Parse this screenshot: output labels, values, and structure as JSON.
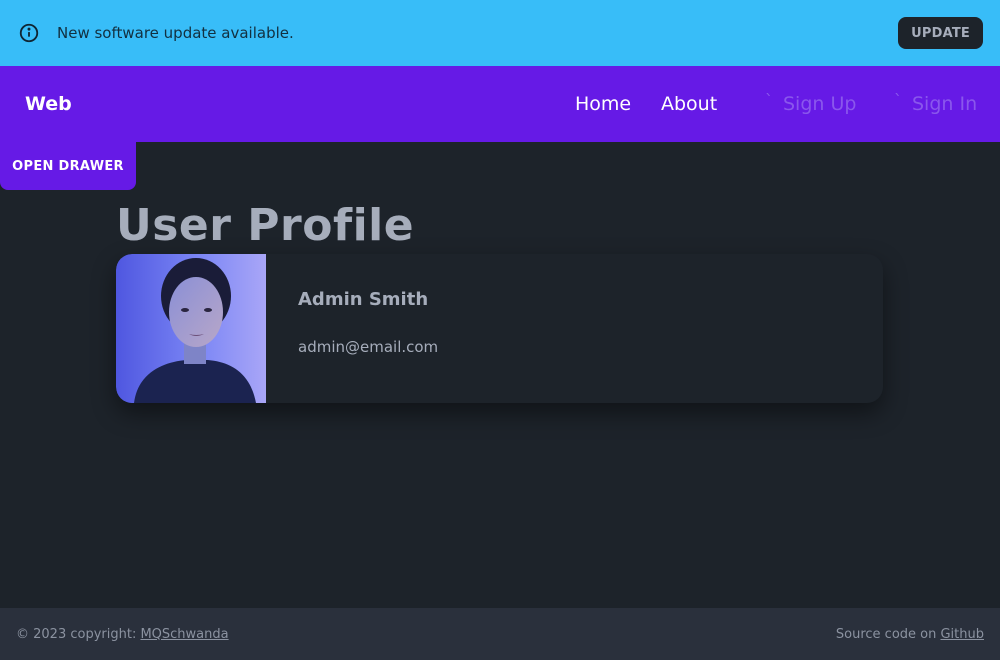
{
  "alert": {
    "message": "New software update available.",
    "button_label": "UPDATE",
    "icon": "info-icon",
    "color": "#38bdf8"
  },
  "navbar": {
    "brand": "Web",
    "links": [
      {
        "label": "Home",
        "active": true
      },
      {
        "label": "About",
        "active": true
      },
      {
        "label": "Sign Up",
        "active": false
      },
      {
        "label": "Sign In",
        "active": false
      }
    ],
    "color": "#661ae6"
  },
  "drawer_button": "OPEN DRAWER",
  "main": {
    "title": "User Profile",
    "profile": {
      "name": "Admin Smith",
      "email": "admin@email.com"
    }
  },
  "footer": {
    "copyright_prefix": "© 2023 copyright: ",
    "author_link": "MQSchwanda",
    "source_prefix": "Source code on ",
    "source_link": "Github"
  }
}
